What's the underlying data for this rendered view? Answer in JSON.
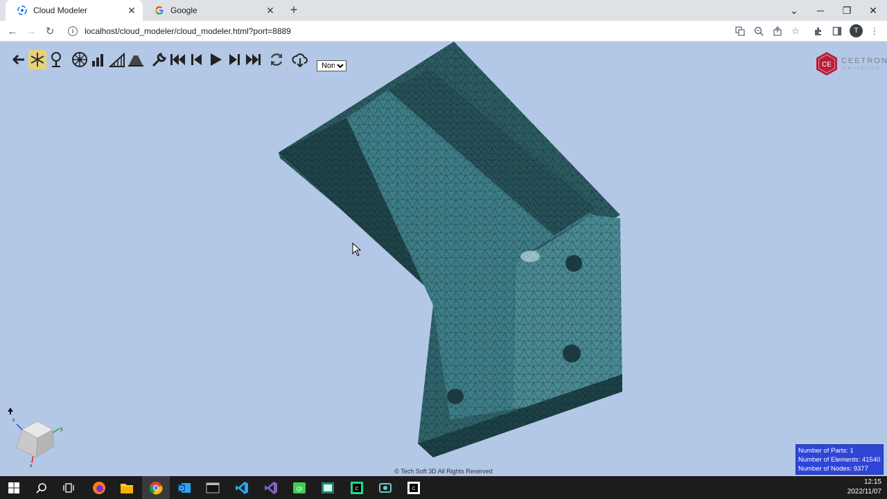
{
  "browser": {
    "tabs": [
      {
        "title": "Cloud Modeler",
        "active": true,
        "icon": "cloud-modeler-icon"
      },
      {
        "title": "Google",
        "active": false,
        "icon": "google-icon"
      }
    ],
    "new_tab_label": "+",
    "url": "localhost/cloud_modeler/cloud_modeler.html?port=8889",
    "profile_initial": "T"
  },
  "toolbar": {
    "tools": [
      "back-arrow-icon",
      "snowflake-icon",
      "tree-icon",
      "wheel-icon",
      "bar-chart-icon",
      "ramp-chart-icon",
      "mountain-icon",
      "wrench-icon",
      "first-frame-icon",
      "previous-frame-icon",
      "play-icon",
      "next-frame-icon",
      "last-frame-icon",
      "refresh-icon",
      "cloud-download-icon"
    ],
    "mode_select": {
      "value": "None",
      "options": [
        "None"
      ]
    }
  },
  "brand": {
    "name": "CEETRON",
    "logo_text": "CE",
    "sub": "SIMULATION"
  },
  "axis": {
    "x": "x",
    "y": "y",
    "z": "z"
  },
  "stats": {
    "parts": "Number of Parts: 1",
    "elements": "Number of Elements: 41540",
    "nodes": "Number of Nodes: 9377"
  },
  "copyright": "© Tech Soft 3D All Rights Reserved",
  "taskbar": {
    "time": "12:15",
    "date": "2022/11/07",
    "apps": [
      "windows-start-icon",
      "search-icon",
      "task-view-icon",
      "firefox-icon",
      "file-explorer-icon",
      "chrome-icon",
      "outlook-icon",
      "terminal-icon",
      "vscode-icon",
      "visual-studio-icon",
      "qt-creator-icon",
      "app-icon",
      "clion-icon",
      "app-icon-2",
      "app-icon-3"
    ]
  },
  "colors": {
    "viewport_bg": "#b3c8e6",
    "mesh": "#3d7d87",
    "stats_bg": "#2f45d6",
    "brand": "#b5203c"
  }
}
